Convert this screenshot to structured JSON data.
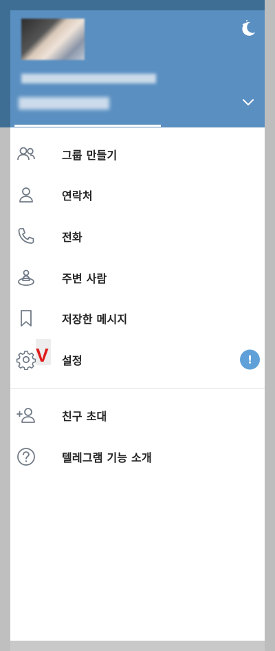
{
  "header": {
    "profile_name": "",
    "profile_phone": ""
  },
  "menu": {
    "primary": [
      {
        "label": "그룹 만들기",
        "icon": "group-icon"
      },
      {
        "label": "연락처",
        "icon": "person-icon"
      },
      {
        "label": "전화",
        "icon": "phone-icon"
      },
      {
        "label": "주변 사람",
        "icon": "people-nearby-icon"
      },
      {
        "label": "저장한 메시지",
        "icon": "bookmark-icon"
      },
      {
        "label": "설정",
        "icon": "gear-icon",
        "badge": "!"
      }
    ],
    "secondary": [
      {
        "label": "친구 초대",
        "icon": "add-person-icon"
      },
      {
        "label": "텔레그램 기능 소개",
        "icon": "help-icon"
      }
    ]
  },
  "annotation": {
    "mark": "V",
    "color": "#e01b1b"
  },
  "colors": {
    "header_bg": "#5a8fc1",
    "badge_bg": "#5fa0d8",
    "icon_stroke": "#707a86"
  }
}
